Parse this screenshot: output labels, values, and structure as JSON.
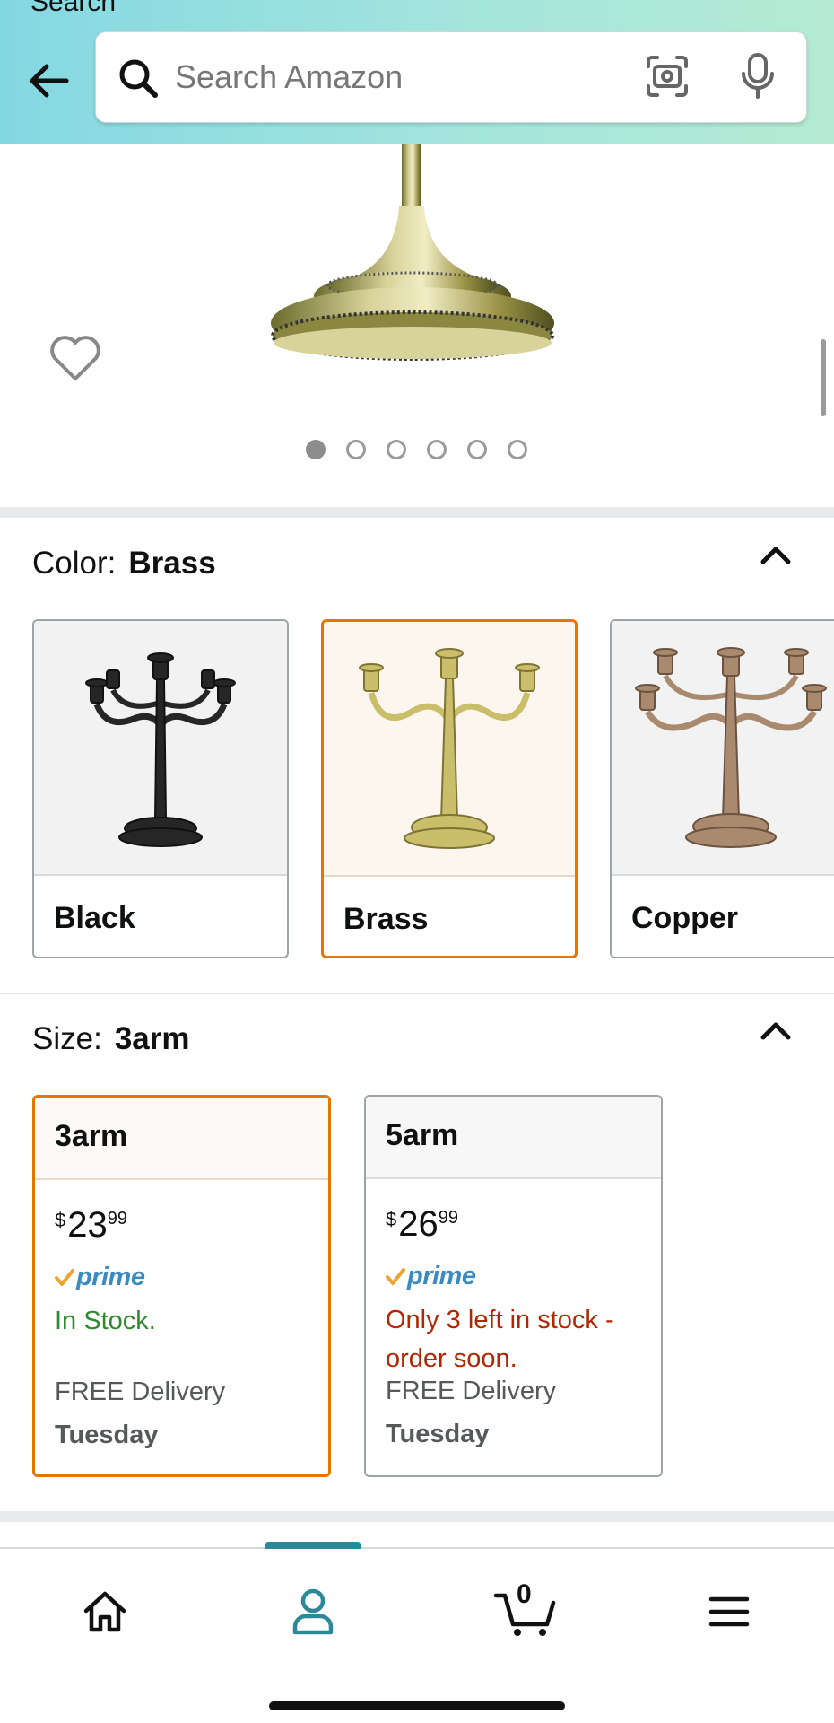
{
  "header": {
    "status_text": "Search",
    "search_placeholder": "Search Amazon"
  },
  "gallery": {
    "dot_count": 6,
    "active_index": 0
  },
  "color": {
    "label": "Color:",
    "selected": "Brass",
    "options": [
      {
        "name": "Black",
        "swatch": "#2b2b2b"
      },
      {
        "name": "Brass",
        "swatch": "#c2b25a"
      },
      {
        "name": "Copper",
        "swatch": "#a98a6e"
      }
    ]
  },
  "size": {
    "label": "Size:",
    "selected": "3arm",
    "options": [
      {
        "name": "3arm",
        "currency": "$",
        "price_whole": "23",
        "price_fraction": "99",
        "prime": "prime",
        "stock": "In Stock.",
        "delivery": "FREE Delivery",
        "day": "Tuesday"
      },
      {
        "name": "5arm",
        "currency": "$",
        "price_whole": "26",
        "price_fraction": "99",
        "prime": "prime",
        "stock": "Only 3 left in stock - order soon.",
        "delivery": "FREE Delivery",
        "day": "Tuesday"
      }
    ]
  },
  "nav": {
    "cart_count": "0",
    "active_tab": "account"
  },
  "colors": {
    "accent": "#e77600",
    "nav_active": "#2a8a99",
    "prime_blue": "#3a8bc0",
    "in_stock": "#2d8a2d",
    "low_stock": "#b12704"
  }
}
